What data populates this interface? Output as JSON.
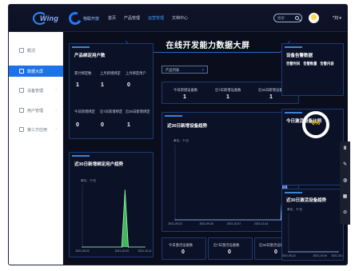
{
  "colors": {
    "accent": "#1a73e8",
    "panel_border": "#1f3a74",
    "ring_value": "#ffd400"
  },
  "header": {
    "logo1_text": "Wing",
    "logo2_text": "物联开放",
    "nav": [
      "首页",
      "产品管理",
      "运营管理",
      "文档中心"
    ],
    "active_nav": "运营管理",
    "search_placeholder": "搜索",
    "user_label": "*刘 ▾"
  },
  "sidebar": {
    "items": [
      {
        "label": "概况",
        "icon": "overview-icon",
        "active": false,
        "arrow": false
      },
      {
        "label": "数据大屏",
        "icon": "screen-icon",
        "active": true,
        "arrow": false
      },
      {
        "label": "设备管理",
        "icon": "device-icon",
        "active": false,
        "arrow": true
      },
      {
        "label": "用户管理",
        "icon": "user-icon",
        "active": false,
        "arrow": true
      },
      {
        "label": "第三方应用",
        "icon": "app-icon",
        "active": false,
        "arrow": true
      }
    ]
  },
  "dashboard": {
    "title": "在线开发能力数据大屏",
    "product_select": "产品列表",
    "product_users": {
      "title": "产品绑定用户数",
      "stats": [
        {
          "label": "累计绑定数",
          "value": "1"
        },
        {
          "label": "上月新增绑定",
          "value": "1"
        },
        {
          "label": "上月绑定用户",
          "value": "0"
        },
        {
          "label": "今日新增绑定",
          "value": "0"
        },
        {
          "label": "近7日新增绑定",
          "value": "0"
        },
        {
          "label": "近30日新增绑定",
          "value": "1"
        }
      ]
    },
    "device_stats_top": [
      {
        "label": "今日新增设备数",
        "value": "1"
      },
      {
        "label": "近7日新增设备数",
        "value": "1"
      },
      {
        "label": "近30日新增设备数",
        "value": "1"
      }
    ],
    "device_stats_bottom": [
      {
        "label": "今日激活设备数",
        "value": "0"
      },
      {
        "label": "近7日激活设备数",
        "value": "0"
      },
      {
        "label": "近30日激活设备数",
        "value": "0"
      }
    ],
    "device_info": {
      "title": "设备告警数据",
      "buttons": [
        "告警时间",
        "告警数量",
        "告警内容"
      ]
    },
    "activation_rate": {
      "title": "今日激活设备比例",
      "value": "0%"
    },
    "chart_unit": "单位：个/日"
  },
  "chart_data": [
    {
      "type": "area",
      "title": "近30日新增绑定用户趋势",
      "x_ticks": [
        "2021-09-22",
        "2021-10-04",
        "2021-10-11"
      ],
      "x": [
        "2021-09-22",
        "2021-10-04",
        "2021-10-05",
        "2021-10-06",
        "2021-10-11"
      ],
      "values": [
        0,
        0,
        1,
        0,
        0
      ]
    },
    {
      "type": "area",
      "title": "近30日新增设备趋势",
      "x_ticks": [
        "2021-09-22",
        "2021-09-30",
        "2021-10-07",
        "2021-10-14",
        "2021-10-21"
      ],
      "x": [
        "2021-09-22",
        "2021-10-19",
        "2021-10-20",
        "2021-10-21"
      ],
      "values": [
        0,
        0,
        1,
        0
      ]
    },
    {
      "type": "area",
      "title": "近30日激活设备趋势",
      "x_ticks": [
        "2021-09-22",
        "2021-10-04",
        "2021-10-11"
      ],
      "x": [
        "2021-09-22",
        "2021-10-11"
      ],
      "values": [
        0,
        0
      ]
    }
  ],
  "float_tools": [
    {
      "icon": "menu-icon",
      "glyph": "Ⅲ"
    },
    {
      "icon": "pen-icon",
      "glyph": "✎"
    },
    {
      "icon": "cylinder-icon",
      "glyph": "◍"
    },
    {
      "icon": "grid-icon",
      "glyph": "▦"
    },
    {
      "icon": "link-icon",
      "glyph": "⊘"
    }
  ]
}
